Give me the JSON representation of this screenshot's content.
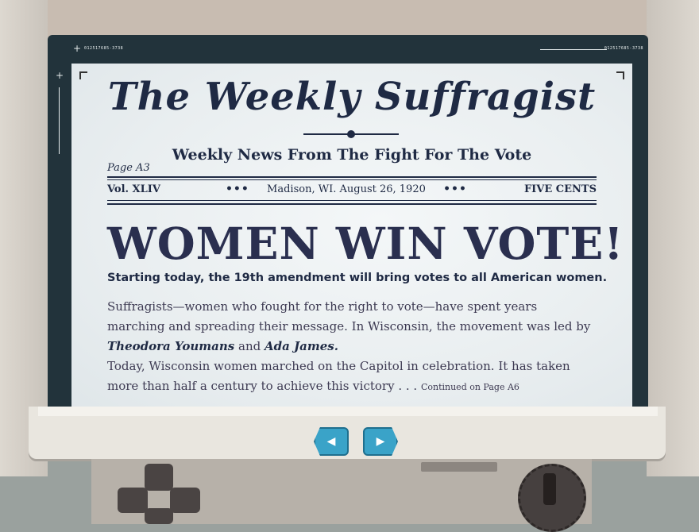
{
  "bezel": {
    "serial_left": "012517685-3738",
    "serial_right": "012517685-3738"
  },
  "newspaper": {
    "masthead": "The Weekly Suffragist",
    "tagline": "Weekly News From The Fight For The Vote",
    "page_ref": "Page A3",
    "volume": "Vol. XLIV",
    "dots": "•••",
    "dateline": "Madison, WI. August 26, 1920",
    "price": "FIVE CENTS",
    "headline": "WOMEN WIN VOTE!",
    "deck": "Starting today, the 19th amendment will bring votes to all American women.",
    "body_p1_a": "Suffragists—women who fought for the right to vote—have spent years marching and spreading their message. In Wisconsin, the movement was led by",
    "name1": "Theodora Youmans",
    "and": "and",
    "name2": "Ada James.",
    "body_p2": "Today, Wisconsin women marched on the Capitol in celebration. It has taken more than half a century to achieve this victory . . .",
    "continued": "Continued on Page A6"
  },
  "nav": {
    "prev_icon": "arrow-left-icon",
    "next_icon": "arrow-right-icon"
  },
  "colors": {
    "ink": "#1f2a44",
    "button": "#3aa3c8",
    "bezel": "#22333b"
  }
}
